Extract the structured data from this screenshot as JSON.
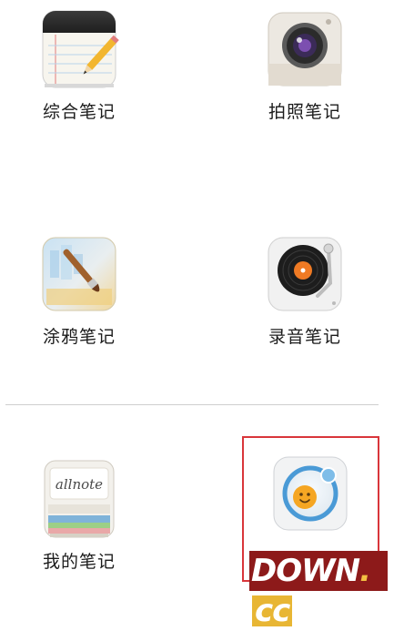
{
  "apps": {
    "row1": [
      {
        "label": "综合笔记",
        "icon": "notepad-pencil-icon"
      },
      {
        "label": "拍照笔记",
        "icon": "camera-icon"
      }
    ],
    "row2": [
      {
        "label": "涂鸦笔记",
        "icon": "paintbrush-canvas-icon"
      },
      {
        "label": "录音笔记",
        "icon": "record-player-icon"
      }
    ],
    "row3": [
      {
        "label": "我的笔记",
        "icon": "allnote-stack-icon",
        "icon_text": "allnote"
      },
      {
        "label": "",
        "icon": "smiley-orbit-icon"
      }
    ]
  },
  "watermark": {
    "main": "DOWN",
    "dot": ".",
    "suffix": "cc"
  },
  "colors": {
    "highlight_border": "#d9363b",
    "watermark_bg": "#8d1a1a",
    "watermark_accent": "#e8b634"
  }
}
